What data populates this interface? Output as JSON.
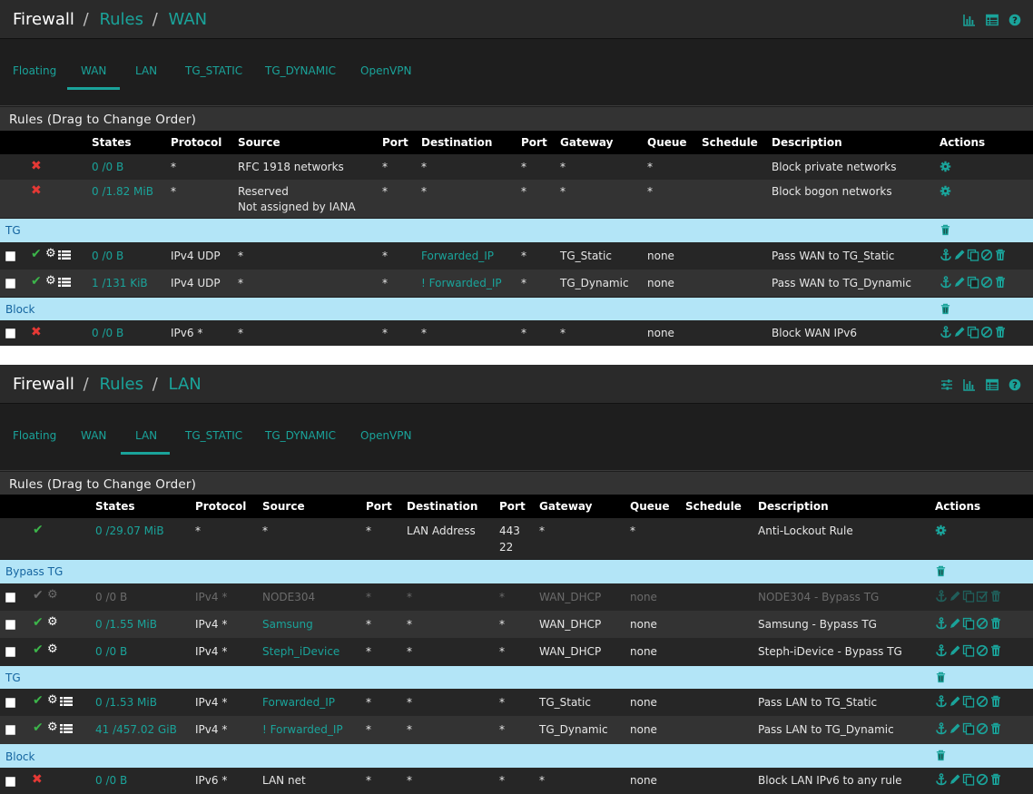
{
  "colors": {
    "accent": "#1aa39a",
    "pass": "#3cb54a",
    "block": "#e53935",
    "separator_bg": "#b3e5f7",
    "separator_text": "#1565a0"
  },
  "wan": {
    "breadcrumb": {
      "main": "Firewall",
      "sep1": "/",
      "link": "Rules",
      "sep2": "/",
      "current": "WAN"
    },
    "tabs": [
      "Floating",
      "WAN",
      "LAN",
      "TG_STATIC",
      "TG_DYNAMIC",
      "OpenVPN"
    ],
    "active_tab": "WAN",
    "section_title": "Rules (Drag to Change Order)",
    "headers": {
      "states": "States",
      "protocol": "Protocol",
      "source": "Source",
      "port": "Port",
      "destination": "Destination",
      "port2": "Port",
      "gateway": "Gateway",
      "queue": "Queue",
      "schedule": "Schedule",
      "description": "Description",
      "actions": "Actions"
    },
    "rules": [
      {
        "states": "0 /0 B",
        "protocol": "*",
        "source": "RFC 1918 networks",
        "port": "*",
        "destination": "*",
        "port2": "*",
        "gateway": "*",
        "queue": "*",
        "schedule": "",
        "description": "Block private networks"
      },
      {
        "states": "0 /1.82 MiB",
        "protocol": "*",
        "source": "Reserved",
        "source2": "Not assigned by IANA",
        "port": "*",
        "destination": "*",
        "port2": "*",
        "gateway": "*",
        "queue": "*",
        "schedule": "",
        "description": "Block bogon networks"
      }
    ],
    "sep_tg": "TG",
    "tg_rules": [
      {
        "states": "0 /0 B",
        "protocol": "IPv4 UDP",
        "source": "*",
        "port": "*",
        "destination": "Forwarded_IP",
        "port2": "*",
        "gateway": "TG_Static",
        "queue": "none",
        "description": "Pass WAN to TG_Static"
      },
      {
        "states": "1 /131 KiB",
        "protocol": "IPv4 UDP",
        "source": "*",
        "port": "*",
        "destination": "! Forwarded_IP",
        "port2": "*",
        "gateway": "TG_Dynamic",
        "queue": "none",
        "description": "Pass WAN to TG_Dynamic"
      }
    ],
    "sep_block": "Block",
    "block_rules": [
      {
        "states": "0 /0 B",
        "protocol": "IPv6 *",
        "source": "*",
        "port": "*",
        "destination": "*",
        "port2": "*",
        "gateway": "*",
        "queue": "none",
        "description": "Block WAN IPv6"
      }
    ]
  },
  "lan": {
    "breadcrumb": {
      "main": "Firewall",
      "sep1": "/",
      "link": "Rules",
      "sep2": "/",
      "current": "LAN"
    },
    "tabs": [
      "Floating",
      "WAN",
      "LAN",
      "TG_STATIC",
      "TG_DYNAMIC",
      "OpenVPN"
    ],
    "active_tab": "LAN",
    "section_title": "Rules (Drag to Change Order)",
    "headers": {
      "states": "States",
      "protocol": "Protocol",
      "source": "Source",
      "port": "Port",
      "destination": "Destination",
      "port2": "Port",
      "gateway": "Gateway",
      "queue": "Queue",
      "schedule": "Schedule",
      "description": "Description",
      "actions": "Actions"
    },
    "anti_lockout": {
      "states": "0 /29.07 MiB",
      "protocol": "*",
      "source": "*",
      "port": "*",
      "destination": "LAN Address",
      "port2a": "443",
      "port2b": "22",
      "gateway": "*",
      "queue": "*",
      "description": "Anti-Lockout Rule"
    },
    "sep_bypass": "Bypass TG",
    "bypass_rules": [
      {
        "states": "0 /0 B",
        "protocol": "IPv4 *",
        "source": "NODE304",
        "port": "*",
        "destination": "*",
        "port2": "*",
        "gateway": "WAN_DHCP",
        "queue": "none",
        "description": "NODE304 - Bypass TG"
      },
      {
        "states": "0 /1.55 MiB",
        "protocol": "IPv4 *",
        "source": "Samsung",
        "port": "*",
        "destination": "*",
        "port2": "*",
        "gateway": "WAN_DHCP",
        "queue": "none",
        "description": "Samsung - Bypass TG"
      },
      {
        "states": "0 /0 B",
        "protocol": "IPv4 *",
        "source": "Steph_iDevice",
        "port": "*",
        "destination": "*",
        "port2": "*",
        "gateway": "WAN_DHCP",
        "queue": "none",
        "description": "Steph-iDevice - Bypass TG"
      }
    ],
    "sep_tg": "TG",
    "tg_rules": [
      {
        "states": "0 /1.53 MiB",
        "protocol": "IPv4 *",
        "source": "Forwarded_IP",
        "port": "*",
        "destination": "*",
        "port2": "*",
        "gateway": "TG_Static",
        "queue": "none",
        "description": "Pass LAN to TG_Static"
      },
      {
        "states": "41 /457.02 GiB",
        "protocol": "IPv4 *",
        "source": "! Forwarded_IP",
        "port": "*",
        "destination": "*",
        "port2": "*",
        "gateway": "TG_Dynamic",
        "queue": "none",
        "description": "Pass LAN to TG_Dynamic"
      }
    ],
    "sep_block": "Block",
    "block_rules": [
      {
        "states": "0 /0 B",
        "protocol": "IPv6 *",
        "source": "LAN net",
        "port": "*",
        "destination": "*",
        "port2": "*",
        "gateway": "*",
        "queue": "none",
        "description": "Block LAN IPv6 to any rule"
      }
    ]
  }
}
